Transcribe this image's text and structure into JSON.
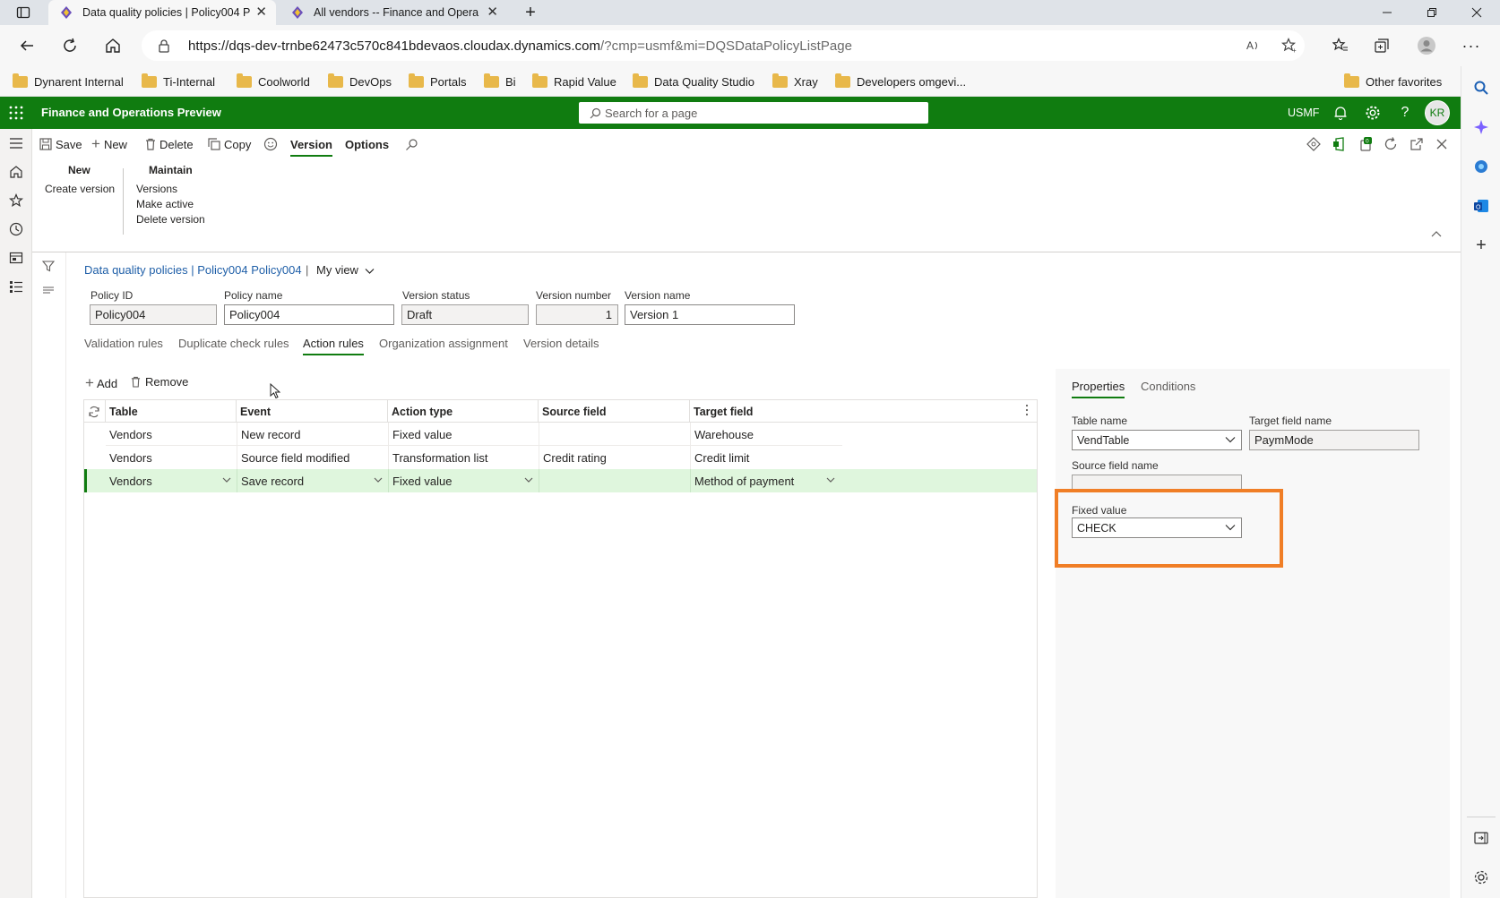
{
  "browser": {
    "tabs": [
      {
        "label": "Data quality policies | Policy004 P",
        "active": true
      },
      {
        "label": "All vendors -- Finance and Opera",
        "active": false
      }
    ],
    "url_host": "https://dqs-dev-trnbe62473c570c841bdevaos.cloudax.dynamics.com",
    "url_path": "/?cmp=usmf&mi=DQSDataPolicyListPage",
    "favorites": [
      "Dynarent Internal",
      "Ti-Internal",
      "Coolworld",
      "DevOps",
      "Portals",
      "Bi",
      "Rapid Value",
      "Data Quality Studio",
      "Xray",
      "Developers omgevi..."
    ],
    "other_favorites": "Other favorites"
  },
  "app": {
    "title": "Finance and Operations Preview",
    "search_placeholder": "Search for a page",
    "company": "USMF",
    "avatar_initials": "KR",
    "brand_color": "#107c10"
  },
  "actionpane": {
    "buttons": {
      "save": "Save",
      "new": "New",
      "delete": "Delete",
      "copy": "Copy"
    },
    "tabs": {
      "version": "Version",
      "options": "Options"
    },
    "groups": {
      "new": {
        "header": "New",
        "items": [
          "Create version"
        ]
      },
      "maintain": {
        "header": "Maintain",
        "items": [
          "Versions",
          "Make active",
          "Delete version"
        ]
      }
    }
  },
  "page": {
    "breadcrumb": "Data quality policies | Policy004 Policy004",
    "separator": "|",
    "view": "My view",
    "fields": {
      "policy_id": {
        "label": "Policy ID",
        "value": "Policy004"
      },
      "policy_name": {
        "label": "Policy name",
        "value": "Policy004"
      },
      "version_status": {
        "label": "Version status",
        "value": "Draft"
      },
      "version_number": {
        "label": "Version number",
        "value": "1"
      },
      "version_name": {
        "label": "Version name",
        "value": "Version 1"
      }
    },
    "tabs": [
      "Validation rules",
      "Duplicate check rules",
      "Action rules",
      "Organization assignment",
      "Version details"
    ],
    "toolbar": {
      "add": "Add",
      "remove": "Remove"
    }
  },
  "grid": {
    "columns": [
      "Table",
      "Event",
      "Action type",
      "Source field",
      "Target field"
    ],
    "rows": [
      [
        "Vendors",
        "New record",
        "Fixed value",
        "",
        "Warehouse"
      ],
      [
        "Vendors",
        "Source field modified",
        "Transformation list",
        "Credit rating",
        "Credit limit"
      ],
      [
        "Vendors",
        "Save record",
        "Fixed value",
        "",
        "Method of payment"
      ]
    ],
    "selected_row": 2,
    "selected_color": "#dff6dd"
  },
  "properties": {
    "tabs": [
      "Properties",
      "Conditions"
    ],
    "table_name": {
      "label": "Table name",
      "value": "VendTable"
    },
    "target_field_name": {
      "label": "Target field name",
      "value": "PaymMode"
    },
    "source_field_name": {
      "label": "Source field name",
      "value": ""
    },
    "fixed_value": {
      "label": "Fixed value",
      "value": "CHECK"
    },
    "highlight_color": "#f07e26"
  }
}
